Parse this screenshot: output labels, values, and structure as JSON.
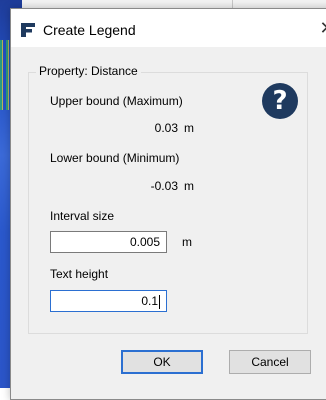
{
  "dialog": {
    "title": "Create Legend",
    "close_glyph": "✕",
    "help_glyph": "?",
    "group_title": "Property: Distance",
    "upper_label": "Upper bound (Maximum)",
    "upper_value": "0.03",
    "upper_unit": "m",
    "lower_label": "Lower bound (Minimum)",
    "lower_value": "-0.03",
    "lower_unit": "m",
    "interval_label": "Interval size",
    "interval_value": "0.005",
    "interval_unit": "m",
    "text_height_label": "Text height",
    "text_height_value": "0.1",
    "ok_label": "OK",
    "cancel_label": "Cancel"
  },
  "colors": {
    "help_icon_bg": "#1f3a5f",
    "focus_border": "#2b6fd1",
    "dialog_bg": "#f0f0f0"
  },
  "icons": {
    "app": "app-logo-icon",
    "close": "close-icon",
    "help": "help-icon"
  }
}
